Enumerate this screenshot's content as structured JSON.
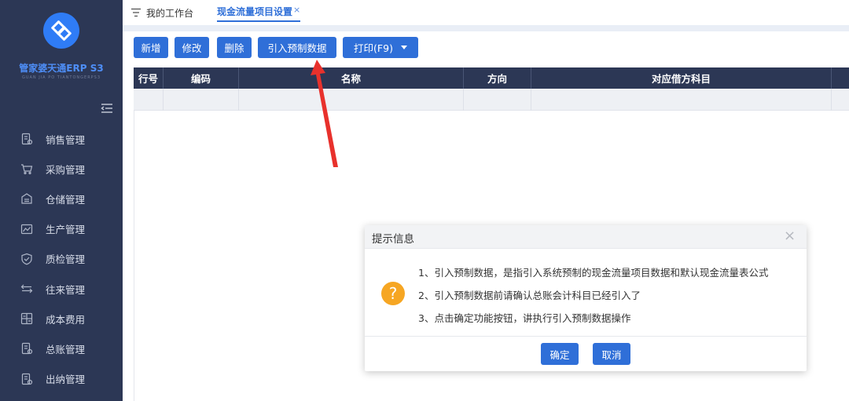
{
  "brand": {
    "name": "管家婆天通ERP S3",
    "subtitle": "GUAN JIA PO TIANTONGERPS3"
  },
  "colors": {
    "sidebar": "#2c3755",
    "accent": "#2f6fd8",
    "warning": "#f6a623",
    "annotation": "#e8312c"
  },
  "sidebar": {
    "collapse_icon": "collapse-menu-icon",
    "items": [
      {
        "label": "销售管理",
        "icon": "document-icon"
      },
      {
        "label": "采购管理",
        "icon": "cart-icon"
      },
      {
        "label": "仓储管理",
        "icon": "warehouse-icon"
      },
      {
        "label": "生产管理",
        "icon": "production-icon"
      },
      {
        "label": "质检管理",
        "icon": "shield-check-icon"
      },
      {
        "label": "往来管理",
        "icon": "exchange-icon"
      },
      {
        "label": "成本费用",
        "icon": "calculator-icon"
      },
      {
        "label": "总账管理",
        "icon": "ledger-icon"
      },
      {
        "label": "出纳管理",
        "icon": "cashier-icon"
      }
    ]
  },
  "tabs": {
    "workbench": "我的工作台",
    "active": "现金流量项目设置",
    "close": "×"
  },
  "toolbar": {
    "add": "新增",
    "edit": "修改",
    "delete": "删除",
    "import": "引入预制数据",
    "print": "打印(F9)"
  },
  "table": {
    "columns": [
      "行号",
      "编码",
      "名称",
      "方向",
      "对应借方科目"
    ]
  },
  "dialog": {
    "title": "提示信息",
    "close": "×",
    "icon": "?",
    "lines": [
      "1、引入预制数据，是指引入系统预制的现金流量项目数据和默认现金流量表公式",
      "2、引入预制数据前请确认总账会计科目已经引入了",
      "3、点击确定功能按钮，讲执行引入预制数据操作"
    ],
    "ok": "确定",
    "cancel": "取消"
  }
}
